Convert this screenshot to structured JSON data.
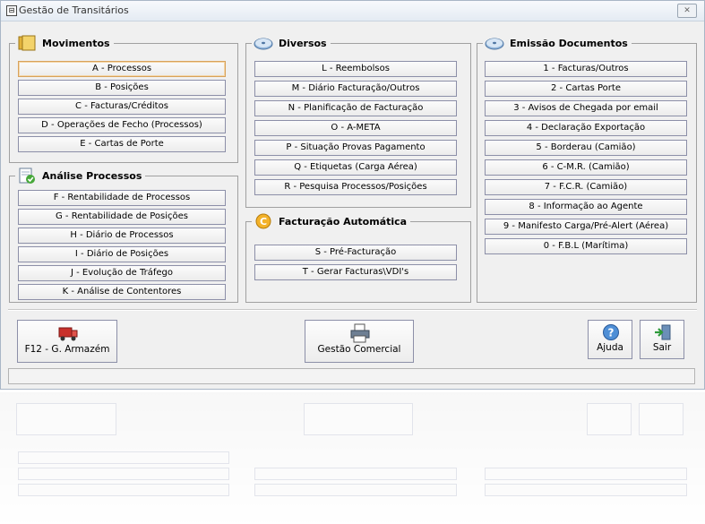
{
  "window": {
    "title": "Gestão de Transitários",
    "close_glyph": "✕"
  },
  "movimentos": {
    "title": "Movimentos",
    "icon": "folder-icon",
    "buttons": [
      "A - Processos",
      "B - Posições",
      "C - Facturas/Créditos",
      "D - Operações de Fecho (Processos)",
      "E - Cartas de Porte"
    ]
  },
  "analise": {
    "title": "Análise Processos",
    "icon": "document-check-icon",
    "buttons": [
      "F - Rentabilidade de Processos",
      "G - Rentabilidade de  Posições",
      "H - Diário de Processos",
      "I - Diário de Posições",
      "J - Evolução de Tráfego",
      "K - Análise de Contentores"
    ]
  },
  "diversos": {
    "title": "Diversos",
    "icon": "disk-icon",
    "buttons": [
      "L - Reembolsos",
      "M - Diário Facturação/Outros",
      "N - Planificação de Facturação",
      "O - A-META",
      "P - Situação Provas Pagamento",
      "Q - Etiquetas (Carga Aérea)",
      "R - Pesquisa Processos/Posições"
    ]
  },
  "facturacao": {
    "title": "Facturação Automática",
    "icon": "coin-icon",
    "buttons": [
      "S - Pré-Facturação",
      "T - Gerar Facturas\\VDI's"
    ]
  },
  "emissao": {
    "title": "Emissão Documentos",
    "icon": "disk-icon",
    "buttons": [
      "1 - Facturas/Outros",
      "2 - Cartas Porte",
      "3 - Avisos de Chegada por email",
      "4 - Declaração Exportação",
      "5 - Borderau (Camião)",
      "6 - C-M.R. (Camião)",
      "7 - F.C.R. (Camião)",
      "8 - Informação ao Agente",
      "9 - Manifesto Carga/Pré-Alert (Aérea)",
      "0 - F.B.L (Marítima)"
    ]
  },
  "bottom": {
    "armazem": "F12 - G. Armazém",
    "comercial": "Gestão Comercial",
    "ajuda": "Ajuda",
    "sair": "Sair"
  },
  "colors": {
    "focus_border": "#d8a25b",
    "button_border": "#8c8fa8",
    "window_bg": "#f0f0f0"
  }
}
